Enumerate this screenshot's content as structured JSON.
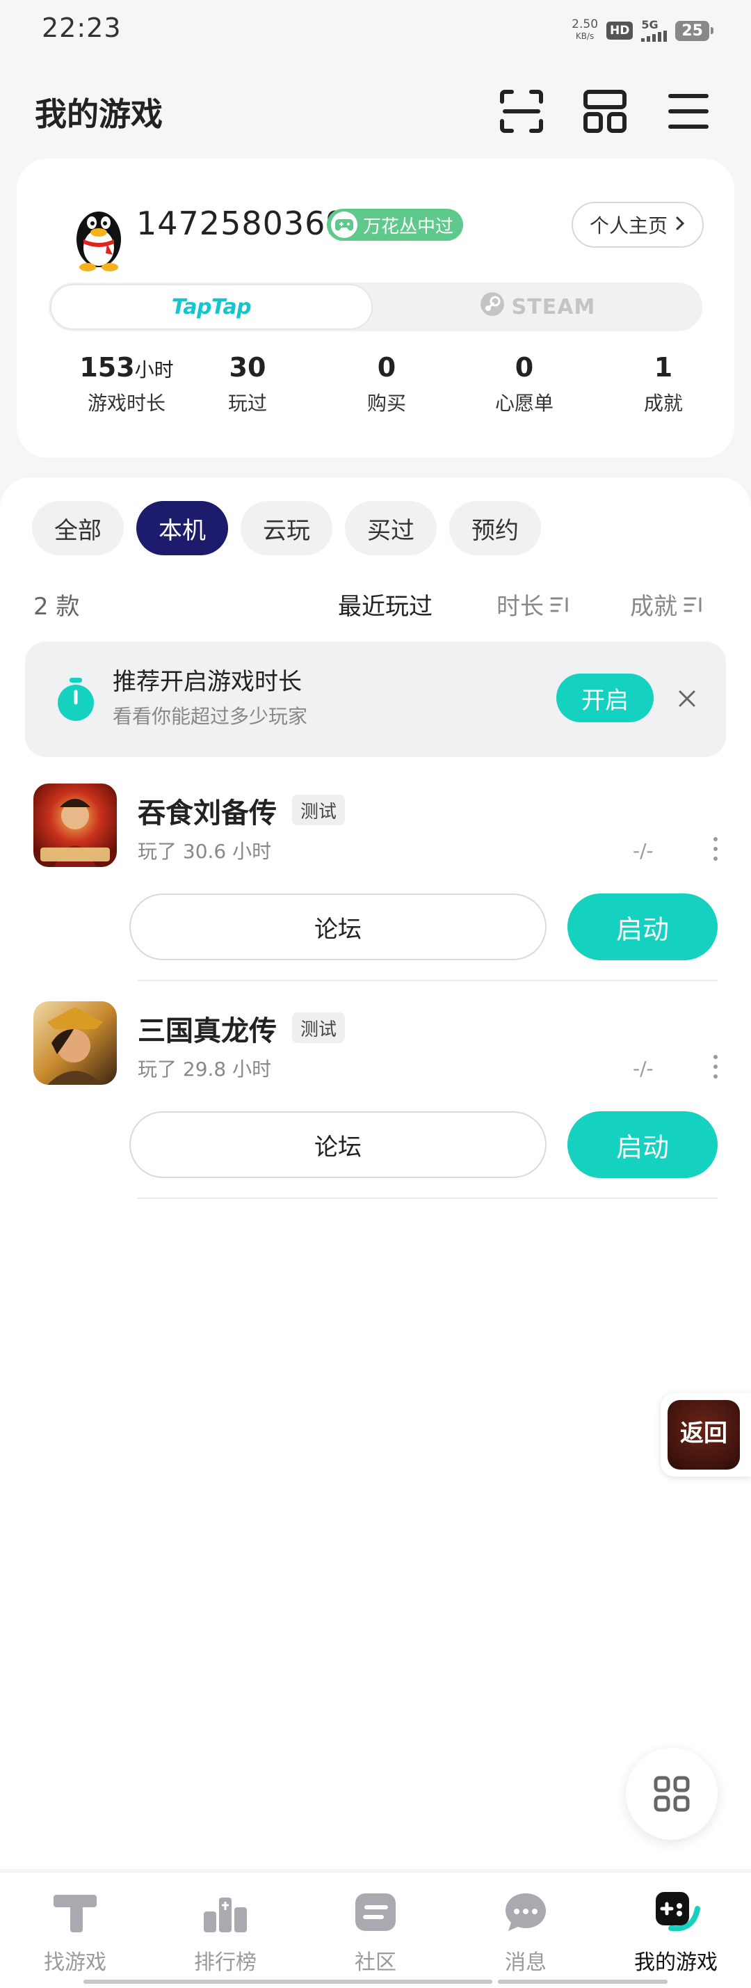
{
  "status_bar": {
    "time": "22:23",
    "net_speed_value": "2.50",
    "net_speed_unit": "KB/s",
    "hd": "HD",
    "network": "5G",
    "battery": "25"
  },
  "header": {
    "title": "我的游戏"
  },
  "profile": {
    "user_id": "1472580369",
    "badge_label": "万花丛中过",
    "profile_link_label": "个人主页",
    "platforms": {
      "taptap": "TapTap",
      "steam": "STEAM"
    },
    "stats": [
      {
        "value": "153",
        "unit": "小时",
        "label": "游戏时长"
      },
      {
        "value": "30",
        "unit": "",
        "label": "玩过"
      },
      {
        "value": "0",
        "unit": "",
        "label": "购买"
      },
      {
        "value": "0",
        "unit": "",
        "label": "心愿单"
      },
      {
        "value": "1",
        "unit": "",
        "label": "成就"
      }
    ]
  },
  "filters": [
    "全部",
    "本机",
    "云玩",
    "买过",
    "预约"
  ],
  "active_filter": "本机",
  "sort_bar": {
    "count": "2 款",
    "options": [
      "最近玩过",
      "时长",
      "成就"
    ]
  },
  "tip": {
    "title": "推荐开启游戏时长",
    "subtitle": "看看你能超过多少玩家",
    "button": "开启"
  },
  "games": [
    {
      "name": "吞食刘备传",
      "tag": "测试",
      "played": "玩了 30.6 小时",
      "score": "-/-",
      "forum_label": "论坛",
      "launch_label": "启动"
    },
    {
      "name": "三国真龙传",
      "tag": "测试",
      "played": "玩了 29.8 小时",
      "score": "-/-",
      "forum_label": "论坛",
      "launch_label": "启动"
    }
  ],
  "float_back_label": "返回",
  "bottom_nav": [
    {
      "label": "找游戏"
    },
    {
      "label": "排行榜"
    },
    {
      "label": "社区"
    },
    {
      "label": "消息"
    },
    {
      "label": "我的游戏"
    }
  ],
  "colors": {
    "accent": "#15d1c0",
    "active_chip": "#1d1b6b",
    "badge": "#5ec98a"
  }
}
